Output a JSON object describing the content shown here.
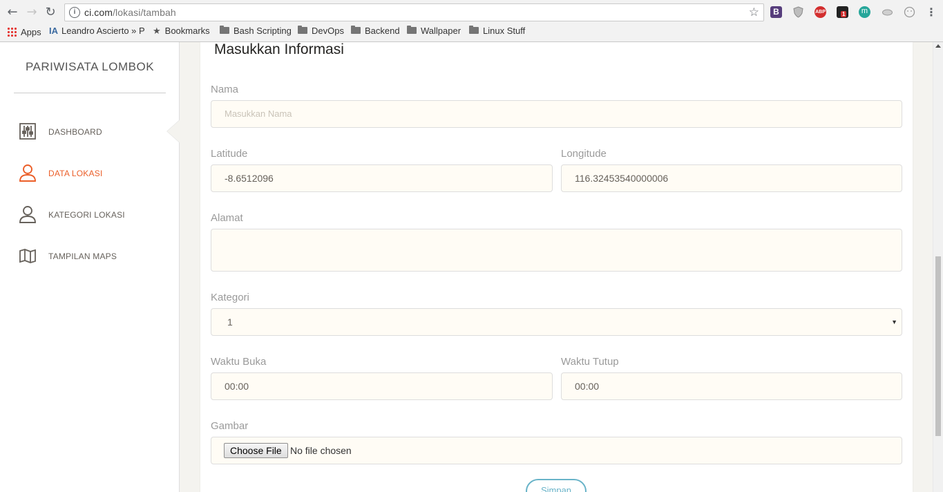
{
  "browser": {
    "url_host": "ci.com",
    "url_path": "/lokasi/tambah",
    "bookmarks": [
      {
        "label": "Apps"
      },
      {
        "label": "Leandro Ascierto » P"
      },
      {
        "label": "Bookmarks"
      },
      {
        "label": "Bash Scripting"
      },
      {
        "label": "DevOps"
      },
      {
        "label": "Backend"
      },
      {
        "label": "Wallpaper"
      },
      {
        "label": "Linux Stuff"
      }
    ],
    "extensions": [
      {
        "name": "bootstrap-icon",
        "text": "B",
        "color": "#563d7c"
      },
      {
        "name": "shield-icon",
        "text": "",
        "color": "#9e9e9e"
      },
      {
        "name": "adblock-icon",
        "text": "ABP",
        "color": "#d32f2f"
      },
      {
        "name": "extension-badge-icon",
        "text": "1",
        "color": "#222222"
      },
      {
        "name": "m-extension-icon",
        "text": "m",
        "color": "#26a69a"
      }
    ]
  },
  "sidebar": {
    "brand": "PARIWISATA LOMBOK",
    "items": [
      {
        "label": "DASHBOARD",
        "icon": "equalizer-icon"
      },
      {
        "label": "DATA LOKASI",
        "icon": "user-icon",
        "active": true
      },
      {
        "label": "KATEGORI LOKASI",
        "icon": "user-icon"
      },
      {
        "label": "TAMPILAN MAPS",
        "icon": "map-icon"
      }
    ]
  },
  "form": {
    "title": "Masukkan Informasi",
    "nama": {
      "label": "Nama",
      "placeholder": "Masukkan Nama",
      "value": ""
    },
    "latitude": {
      "label": "Latitude",
      "value": "-8.6512096"
    },
    "longitude": {
      "label": "Longitude",
      "value": "116.32453540000006"
    },
    "alamat": {
      "label": "Alamat",
      "value": ""
    },
    "kategori": {
      "label": "Kategori",
      "value": "1"
    },
    "waktu_buka": {
      "label": "Waktu Buka",
      "value": "00:00"
    },
    "waktu_tutup": {
      "label": "Waktu Tutup",
      "value": "00:00"
    },
    "gambar": {
      "label": "Gambar",
      "button": "Choose File",
      "status": "No file chosen"
    },
    "submit": "Simpan"
  },
  "colors": {
    "accent": "#eb5e28",
    "info": "#68b3c8",
    "input_bg": "#fffcf5"
  }
}
